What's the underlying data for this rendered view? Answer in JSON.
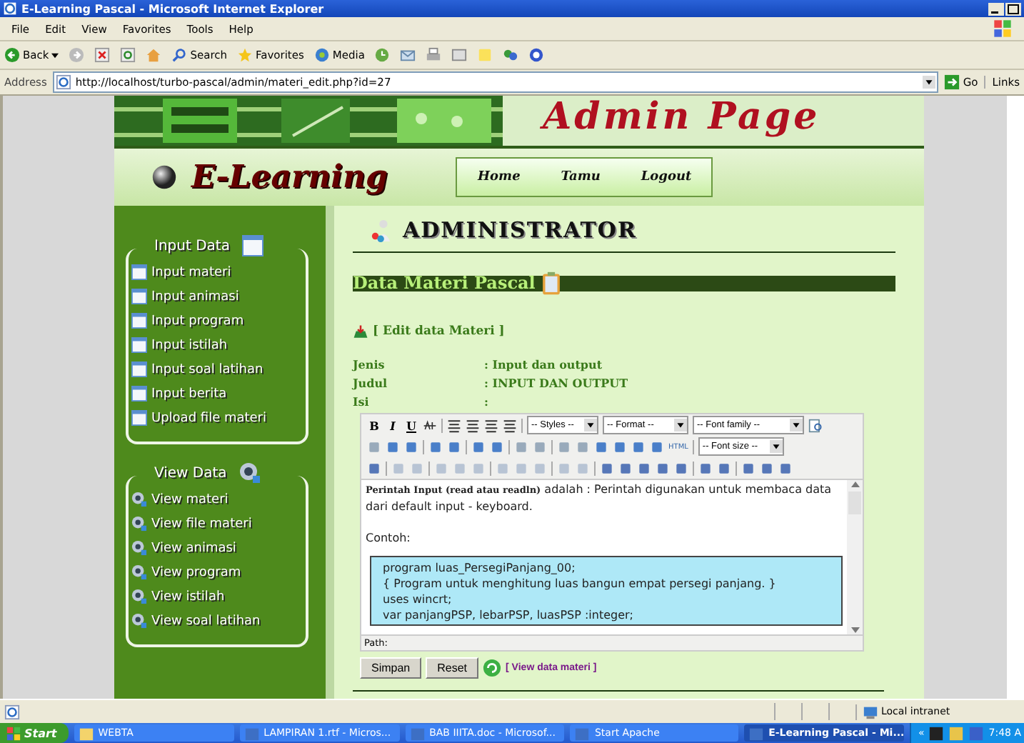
{
  "window": {
    "title": "E-Learning Pascal - Microsoft Internet Explorer"
  },
  "menu": [
    "File",
    "Edit",
    "View",
    "Favorites",
    "Tools",
    "Help"
  ],
  "toolbar": {
    "back": "Back",
    "search": "Search",
    "favorites": "Favorites",
    "media": "Media"
  },
  "address": {
    "label": "Address",
    "url": "http://localhost/turbo-pascal/admin/materi_edit.php?id=27",
    "go": "Go",
    "links": "Links"
  },
  "banner": {
    "title": "Admin Page",
    "logo": "E-Learning",
    "nav": [
      "Home",
      "Tamu",
      "Logout"
    ]
  },
  "sidebar": [
    {
      "title": "Input Data",
      "kind": "input",
      "items": [
        "Input materi",
        "Input animasi",
        "Input program",
        "Input istilah",
        "Input soal latihan",
        "Input berita",
        "Upload file materi"
      ]
    },
    {
      "title": "View Data",
      "kind": "view",
      "items": [
        "View materi",
        "View file materi",
        "View animasi",
        "View program",
        "View istilah",
        "View soal latihan"
      ]
    }
  ],
  "heading": "ADMINISTRATOR",
  "section_title": "Data Materi Pascal",
  "edit_link": "[ Edit data Materi ]",
  "fields": [
    {
      "label": "Jenis",
      "value": ": Input dan output"
    },
    {
      "label": "Judul",
      "value": ": INPUT DAN OUTPUT"
    },
    {
      "label": "Isi",
      "value": ":"
    }
  ],
  "editor": {
    "format_buttons": [
      "B",
      "I",
      "U"
    ],
    "selects": [
      "-- Styles --",
      "-- Format --",
      "-- Font family --"
    ],
    "font_size": "-- Font size --",
    "html": "HTML",
    "text": "**Perintah Input (read atau readln)** adalah : Perintah digunakan untuk membaca data dari default input - keyboard.",
    "example_label": "Contoh:",
    "code": [
      "program luas_PersegiPanjang_00;",
      "{ Program untuk menghitung luas bangun empat persegi panjang. }",
      "uses wincrt;",
      "var panjangPSP, lebarPSP, luasPSP :integer;"
    ],
    "path": "Path:"
  },
  "buttons": [
    "Simpan",
    "Reset"
  ],
  "view_link": "[ View data materi ]",
  "status_bar": {
    "zone": "Local intranet"
  },
  "taskbar": {
    "start": "Start",
    "tasks": [
      {
        "label": "WEBTA",
        "selected": false
      },
      {
        "label": "LAMPIRAN 1.rtf - Micros...",
        "selected": false
      },
      {
        "label": "BAB IIITA.doc - Microsof...",
        "selected": false
      },
      {
        "label": "Start Apache",
        "selected": false
      },
      {
        "label": "E-Learning Pascal - Mi...",
        "selected": true
      }
    ],
    "tray": "«",
    "clock": "7:48 A"
  }
}
